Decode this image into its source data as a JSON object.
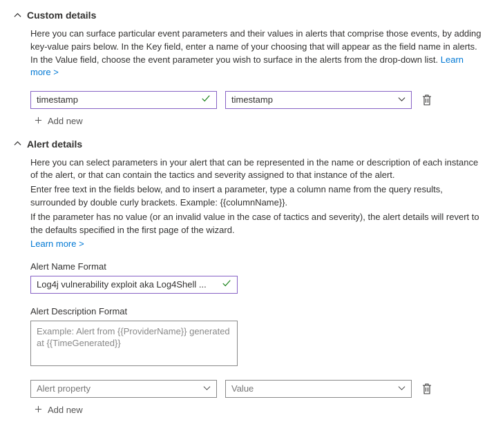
{
  "custom_details": {
    "title": "Custom details",
    "desc": "Here you can surface particular event parameters and their values in alerts that comprise those events, by adding key-value pairs below. In the Key field, enter a name of your choosing that will appear as the field name in alerts. In the Value field, choose the event parameter you wish to surface in the alerts from the drop-down list.",
    "learn_more": "Learn more >",
    "key_value": "timestamp",
    "value_value": "timestamp",
    "add_new": "Add new"
  },
  "alert_details": {
    "title": "Alert details",
    "desc1": "Here you can select parameters in your alert that can be represented in the name or description of each instance of the alert, or that can contain the tactics and severity assigned to that instance of the alert.",
    "desc2": "Enter free text in the fields below, and to insert a parameter, type a column name from the query results, surrounded by double curly brackets. Example: {{columnName}}.",
    "desc3": "If the parameter has no value (or an invalid value in the case of tactics and severity), the alert details will revert to the defaults specified in the first page of the wizard.",
    "learn_more": "Learn more >",
    "name_format_label": "Alert Name Format",
    "name_format_value": "Log4j vulnerability exploit aka Log4Shell ...",
    "desc_format_label": "Alert Description Format",
    "desc_format_placeholder": "Example: Alert from {{ProviderName}} generated at {{TimeGenerated}}",
    "property_placeholder": "Alert property",
    "value_placeholder": "Value",
    "add_new": "Add new"
  }
}
